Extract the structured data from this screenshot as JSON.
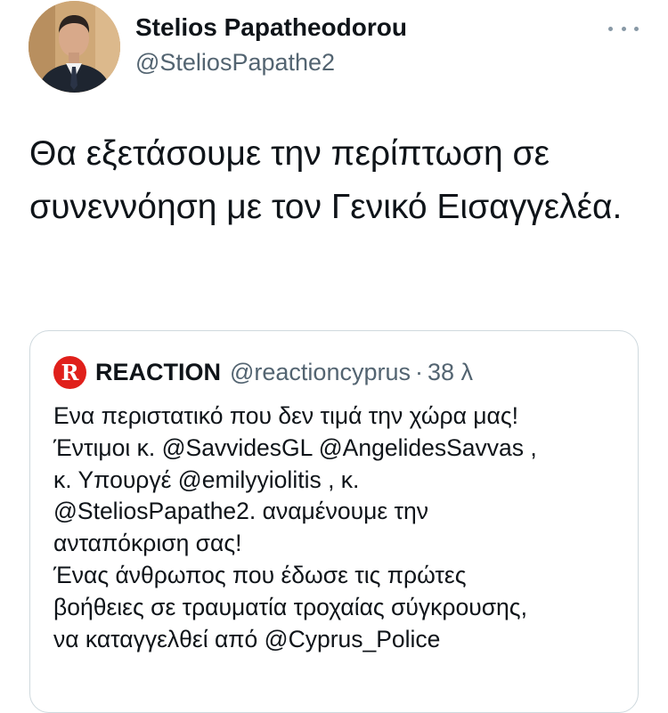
{
  "tweet": {
    "author_name": "Stelios Papatheodorou",
    "author_handle": "@SteliosPapathe2",
    "more_icon": "more-horizontal-icon",
    "text": "Θα εξετάσουμε την περίπτωση σε συνεννόηση με τον Γενικό Εισαγγελέα."
  },
  "quote": {
    "logo_letter": "R",
    "name": "REACTION",
    "handle": "@reactioncyprus",
    "separator": "·",
    "time": "38 λ",
    "lines": [
      "Ενα περιστατικό που δεν τιμά την χώρα μας!",
      "Έντιμοι κ. @SavvidesGL @AngelidesSavvas ,",
      "κ. Υπουργέ @emilyyiolitis , κ.",
      "@SteliosPapathe2. αναμένουμε την",
      "ανταπόκριση σας!",
      "Ένας άνθρωπος που έδωσε τις πρώτες",
      "βοήθειες σε τραυματία τροχαίας σύγκρουσης,",
      "να καταγγελθεί από  @Cyprus_Police"
    ]
  },
  "colors": {
    "text": "#0f1419",
    "secondary": "#536471",
    "border": "#cfd9de",
    "logo_red": "#e0201b"
  }
}
